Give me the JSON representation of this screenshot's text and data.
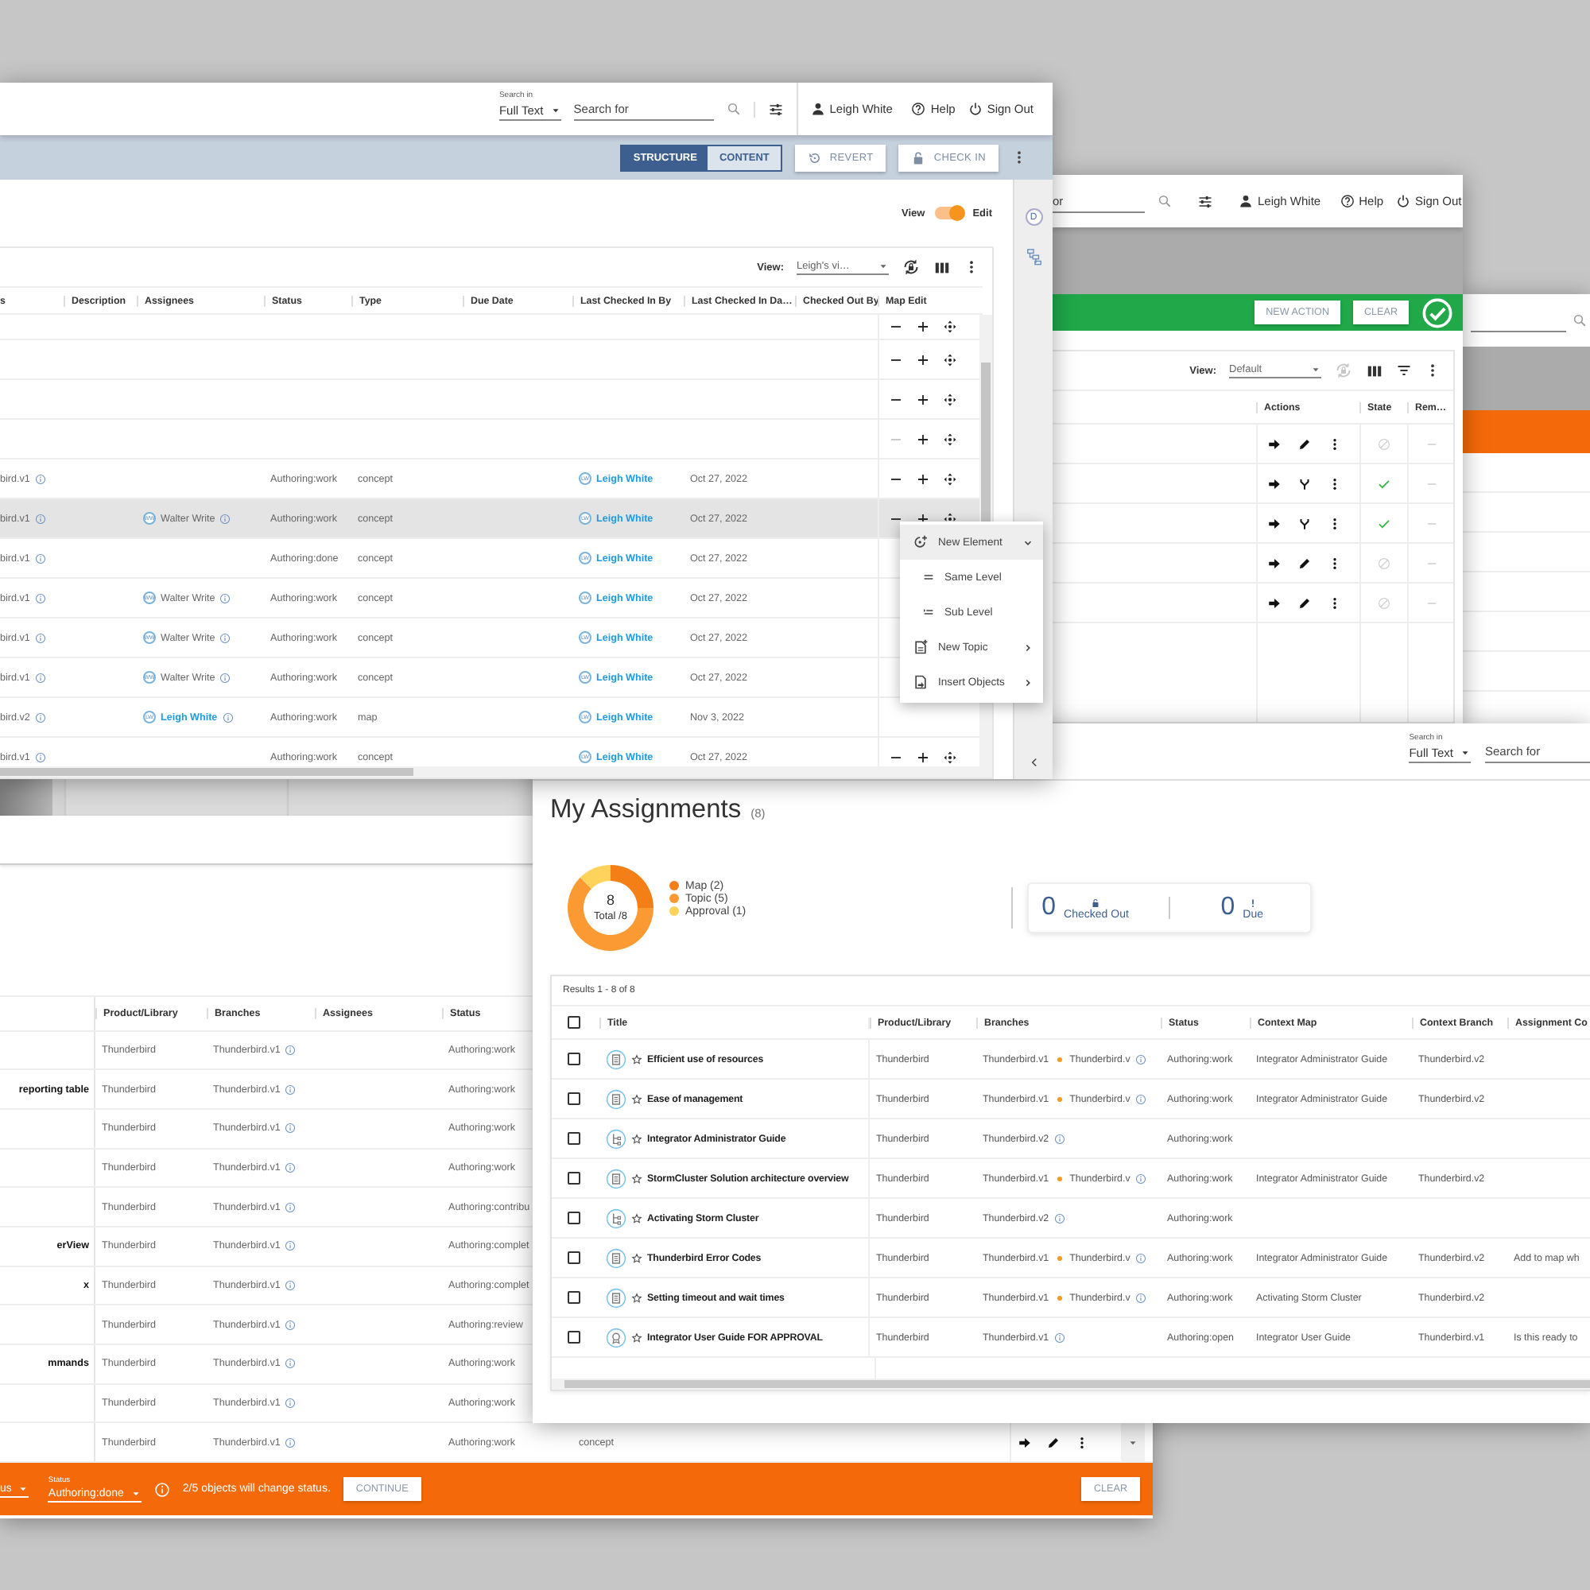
{
  "main_window": {
    "header": {
      "search_scope_label": "Search in",
      "search_scope": "Full Text",
      "search_placeholder": "Search for",
      "user": "Leigh White",
      "help": "Help",
      "sign_out": "Sign Out"
    },
    "mode_tabs": [
      {
        "label": "STRUCTURE",
        "selected": true
      },
      {
        "label": "CONTENT",
        "selected": false
      }
    ],
    "toolbar_buttons": [
      {
        "label": "REVERT",
        "kind": "revert"
      },
      {
        "label": "CHECK IN",
        "kind": "check_in"
      }
    ],
    "view_toggle": {
      "left_label": "View",
      "right_label": "Edit",
      "on": true
    },
    "side_panel": {
      "badge": "D"
    },
    "table": {
      "view_label": "View:",
      "view_value": "Leigh's vi…",
      "columns": [
        "s",
        "Description",
        "Assignees",
        "Status",
        "Type",
        "Due Date",
        "Last Checked In By",
        "Last Checked In Da…",
        "Checked Out By",
        "Map Edit"
      ],
      "rows": [
        {
          "selected": false,
          "remove_disabled": false
        },
        {
          "selected": false,
          "remove_disabled": false
        },
        {
          "selected": false,
          "remove_disabled": false
        },
        {
          "selected": false,
          "remove_disabled": true
        },
        {
          "branch": "bird.v1",
          "status": "Authoring:work",
          "type": "concept",
          "checked_in_by": {
            "initials": "LW",
            "name": "Leigh White"
          },
          "checked_in_date": "Oct 27, 2022",
          "selected": false,
          "remove_disabled": false
        },
        {
          "branch": "bird.v1",
          "assignee": {
            "initials": "WW",
            "name": "Walter Write",
            "link": false
          },
          "status": "Authoring:work",
          "type": "concept",
          "checked_in_by": {
            "initials": "LW",
            "name": "Leigh White"
          },
          "checked_in_date": "Oct 27, 2022",
          "selected": true,
          "remove_disabled": false
        },
        {
          "branch": "bird.v1",
          "status": "Authoring:done",
          "type": "concept",
          "checked_in_by": {
            "initials": "LW",
            "name": "Leigh White"
          },
          "checked_in_date": "Oct 27, 2022",
          "selected": false
        },
        {
          "branch": "bird.v1",
          "assignee": {
            "initials": "WW",
            "name": "Walter Write",
            "link": false
          },
          "status": "Authoring:work",
          "type": "concept",
          "checked_in_by": {
            "initials": "LW",
            "name": "Leigh White"
          },
          "checked_in_date": "Oct 27, 2022",
          "selected": false
        },
        {
          "branch": "bird.v1",
          "assignee": {
            "initials": "WW",
            "name": "Walter Write",
            "link": false
          },
          "status": "Authoring:work",
          "type": "concept",
          "checked_in_by": {
            "initials": "LW",
            "name": "Leigh White"
          },
          "checked_in_date": "Oct 27, 2022",
          "selected": false
        },
        {
          "branch": "bird.v1",
          "assignee": {
            "initials": "WW",
            "name": "Walter Write",
            "link": false
          },
          "status": "Authoring:work",
          "type": "concept",
          "checked_in_by": {
            "initials": "LW",
            "name": "Leigh White"
          },
          "checked_in_date": "Oct 27, 2022",
          "selected": false
        },
        {
          "branch": "bird.v2",
          "assignee": {
            "initials": "LW",
            "name": "Leigh White",
            "link": true
          },
          "status": "Authoring:work",
          "type": "map",
          "checked_in_by": {
            "initials": "LW",
            "name": "Leigh White"
          },
          "checked_in_date": "Nov 3, 2022",
          "selected": false
        },
        {
          "branch": "bird.v1",
          "status": "Authoring:work",
          "type": "concept",
          "checked_in_by": {
            "initials": "LW",
            "name": "Leigh White"
          },
          "checked_in_date": "Oct 27, 2022",
          "selected": false,
          "remove_disabled": false
        }
      ]
    },
    "context_menu": [
      {
        "label": "New Element",
        "kind": "new_element",
        "expanded": true,
        "highlighted": true,
        "children": [
          {
            "label": "Same Level",
            "kind": "same_level"
          },
          {
            "label": "Sub Level",
            "kind": "sub_level"
          }
        ]
      },
      {
        "label": "New Topic",
        "kind": "new_topic",
        "expanded": false,
        "highlighted": false
      },
      {
        "label": "Insert Objects",
        "kind": "insert",
        "expanded": false,
        "highlighted": false
      }
    ]
  },
  "actions_window": {
    "header": {
      "search_placeholder": "or",
      "user": "Leigh White",
      "help": "Help",
      "sign_out": "Sign Out"
    },
    "action_bar": {
      "buttons": [
        "NEW ACTION",
        "CLEAR"
      ]
    },
    "table": {
      "view_label": "View:",
      "view_value": "Default",
      "columns": [
        "Actions",
        "State",
        "Rem…"
      ],
      "rows": [
        {
          "kind": "edit",
          "done": false
        },
        {
          "kind": "branch",
          "done": true
        },
        {
          "kind": "branch",
          "done": true
        },
        {
          "kind": "edit",
          "done": false
        },
        {
          "kind": "edit",
          "done": false
        }
      ]
    }
  },
  "status_window": {
    "columns": [
      "Product/Library",
      "Branches",
      "Assignees",
      "Status"
    ],
    "rows": [
      {
        "product": "Thunderbird",
        "branch": "Thunderbird.v1",
        "status": "Authoring:work"
      },
      {
        "title": "reporting table",
        "product": "Thunderbird",
        "branch": "Thunderbird.v1",
        "status": "Authoring:work"
      },
      {
        "product": "Thunderbird",
        "branch": "Thunderbird.v1",
        "status": "Authoring:work"
      },
      {
        "product": "Thunderbird",
        "branch": "Thunderbird.v1",
        "status": "Authoring:work"
      },
      {
        "product": "Thunderbird",
        "branch": "Thunderbird.v1",
        "status": "Authoring:contribu"
      },
      {
        "title": "erView",
        "product": "Thunderbird",
        "branch": "Thunderbird.v1",
        "status": "Authoring:complet"
      },
      {
        "title": "x",
        "product": "Thunderbird",
        "branch": "Thunderbird.v1",
        "status": "Authoring:complet"
      },
      {
        "product": "Thunderbird",
        "branch": "Thunderbird.v1",
        "status": "Authoring:review"
      },
      {
        "title": "mmands",
        "product": "Thunderbird",
        "branch": "Thunderbird.v1",
        "status": "Authoring:work"
      },
      {
        "product": "Thunderbird",
        "branch": "Thunderbird.v1",
        "status": "Authoring:work"
      },
      {
        "product": "Thunderbird",
        "branch": "Thunderbird.v1",
        "status": "Authoring:work",
        "doc_type": "concept"
      }
    ],
    "footer": {
      "bulk_value": "us",
      "status_label": "Status",
      "status_value": "Authoring:done",
      "message": "2/5 objects will change status.",
      "continue": "CONTINUE",
      "clear": "CLEAR"
    }
  },
  "assignments_window": {
    "header": {
      "search_scope_label": "Search in",
      "search_scope": "Full Text",
      "search_placeholder": "Search for"
    },
    "title": "My Assignments",
    "count": "(8)",
    "summary": {
      "total": "8",
      "total_label": "Total /8",
      "chart_data": {
        "type": "donut",
        "categories": [
          "Map (2)",
          "Topic (5)",
          "Approval (1)"
        ],
        "values": [
          2,
          5,
          1
        ],
        "colors": [
          "#f57f17",
          "#fb9a32",
          "#fdd35c"
        ]
      }
    },
    "stats": [
      {
        "value": "0",
        "label": "Checked Out",
        "kind": "lock"
      },
      {
        "value": "0",
        "label": "Due",
        "kind": "alert"
      }
    ],
    "results_label": "Results 1 - 8 of 8",
    "all_checked": false,
    "columns": [
      "Title",
      "Product/Library",
      "Branches",
      "Status",
      "Context Map",
      "Context Branch",
      "Assignment Co"
    ],
    "rows": [
      {
        "kind": "topic",
        "checked": false,
        "starred": false,
        "title": "Efficient use of resources",
        "product": "Thunderbird",
        "branches": [
          "Thunderbird.v1",
          "Thunderbird.v"
        ],
        "status": "Authoring:work",
        "context_map": "Integrator Administrator Guide",
        "context_branch": "Thunderbird.v2"
      },
      {
        "kind": "topic",
        "checked": false,
        "starred": false,
        "title": "Ease of management",
        "product": "Thunderbird",
        "branches": [
          "Thunderbird.v1",
          "Thunderbird.v"
        ],
        "status": "Authoring:work",
        "context_map": "Integrator Administrator Guide",
        "context_branch": "Thunderbird.v2"
      },
      {
        "kind": "map",
        "checked": false,
        "starred": false,
        "title": "Integrator Administrator Guide",
        "product": "Thunderbird",
        "branches": [
          "Thunderbird.v2"
        ],
        "status": "Authoring:work"
      },
      {
        "kind": "topic",
        "checked": false,
        "starred": false,
        "title": "StormCluster Solution architecture overview",
        "product": "Thunderbird",
        "branches": [
          "Thunderbird.v1",
          "Thunderbird.v"
        ],
        "status": "Authoring:work",
        "context_map": "Integrator Administrator Guide",
        "context_branch": "Thunderbird.v2"
      },
      {
        "kind": "map",
        "checked": false,
        "starred": false,
        "title": "Activating Storm Cluster",
        "product": "Thunderbird",
        "branches": [
          "Thunderbird.v2"
        ],
        "status": "Authoring:work"
      },
      {
        "kind": "topic",
        "checked": false,
        "starred": false,
        "title": "Thunderbird Error Codes",
        "product": "Thunderbird",
        "branches": [
          "Thunderbird.v1",
          "Thunderbird.v"
        ],
        "status": "Authoring:work",
        "context_map": "Integrator Administrator Guide",
        "context_branch": "Thunderbird.v2",
        "comment": "Add to map wh"
      },
      {
        "kind": "topic",
        "checked": false,
        "starred": false,
        "title": "Setting timeout and wait times",
        "product": "Thunderbird",
        "branches": [
          "Thunderbird.v1",
          "Thunderbird.v"
        ],
        "status": "Authoring:work",
        "context_map": "Activating Storm Cluster",
        "context_branch": "Thunderbird.v2"
      },
      {
        "kind": "approval",
        "checked": false,
        "starred": false,
        "title": "Integrator User Guide FOR APPROVAL",
        "product": "Thunderbird",
        "branches": [
          "Thunderbird.v1"
        ],
        "status": "Authoring:open",
        "context_map": "Integrator User Guide",
        "context_branch": "Thunderbird.v1",
        "comment": "Is this ready to"
      }
    ]
  }
}
